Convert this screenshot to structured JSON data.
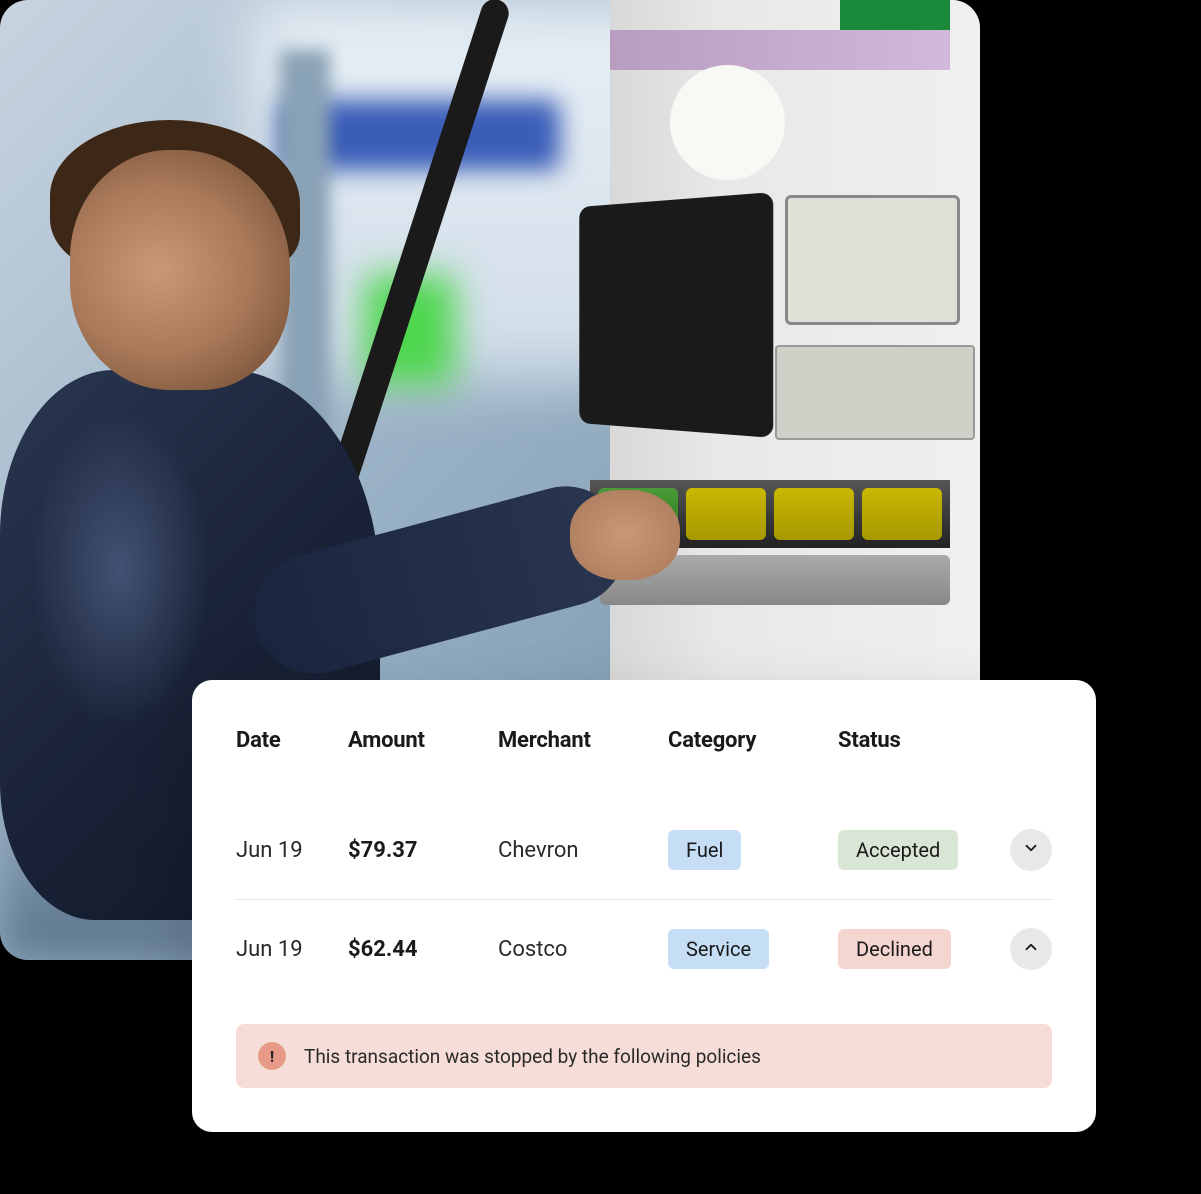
{
  "table": {
    "headers": {
      "date": "Date",
      "amount": "Amount",
      "merchant": "Merchant",
      "category": "Category",
      "status": "Status"
    },
    "rows": [
      {
        "date": "Jun 19",
        "amount": "$79.37",
        "merchant": "Chevron",
        "category": "Fuel",
        "status": "Accepted",
        "expanded": false
      },
      {
        "date": "Jun 19",
        "amount": "$62.44",
        "merchant": "Costco",
        "category": "Service",
        "status": "Declined",
        "expanded": true
      }
    ]
  },
  "policy_banner": {
    "alert_glyph": "!",
    "message": "This transaction was stopped by the following policies"
  },
  "colors": {
    "badge_blue": "#c5ddf5",
    "badge_green": "#d9e5d5",
    "badge_red": "#f5d5d0",
    "banner_bg": "#f7ddd7",
    "alert_bg": "#e89a88"
  }
}
